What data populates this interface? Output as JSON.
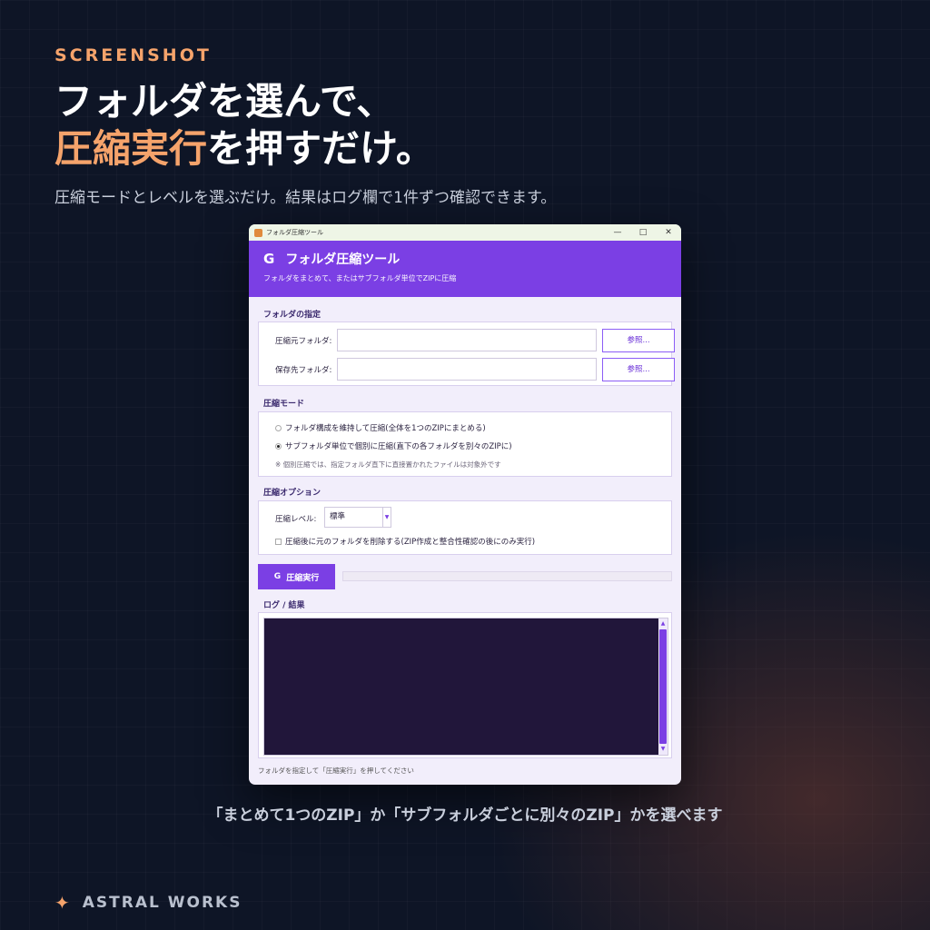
{
  "promo": {
    "eyebrow": "SCREENSHOT",
    "headline_line1": "フォルダを選んで、",
    "headline_accent": "圧縮実行",
    "headline_rest": "を押すだけ。",
    "subline": "圧縮モードとレベルを選ぶだけ。結果はログ欄で1件ずつ確認できます。",
    "caption": "「まとめて1つのZIP」か「サブフォルダごとに別々のZIP」かを選べます",
    "brand": "ASTRAL WORKS"
  },
  "window": {
    "titlebar_title": "フォルダ圧縮ツール",
    "header": {
      "icon_glyph": "G",
      "title": "フォルダ圧縮ツール",
      "subtitle": "フォルダをまとめて、またはサブフォルダ単位でZIPに圧縮"
    },
    "folders": {
      "section_title": "フォルダの指定",
      "source_label": "圧縮元フォルダ:",
      "source_value": "",
      "dest_label": "保存先フォルダ:",
      "dest_value": "",
      "browse_label": "参照..."
    },
    "mode": {
      "section_title": "圧縮モード",
      "option1": "フォルダ構成を維持して圧縮(全体を1つのZIPにまとめる)",
      "option2": "サブフォルダ単位で個別に圧縮(直下の各フォルダを別々のZIPに)",
      "selected": 2,
      "note": "※ 個別圧縮では、指定フォルダ直下に直接置かれたファイルは対象外です"
    },
    "options": {
      "section_title": "圧縮オプション",
      "level_label": "圧縮レベル:",
      "level_value": "標準",
      "delete_label": "圧縮後に元のフォルダを削除する(ZIP作成と整合性確認の後にのみ実行)",
      "delete_checked": false
    },
    "run": {
      "button_label": "圧縮実行",
      "progress": 0
    },
    "log": {
      "section_title": "ログ / 結果",
      "content": ""
    },
    "status": "フォルダを指定して「圧縮実行」を押してください"
  },
  "colors": {
    "accent": "#7b3fe4",
    "orange": "#f5a36b",
    "log_bg": "#21163a"
  }
}
